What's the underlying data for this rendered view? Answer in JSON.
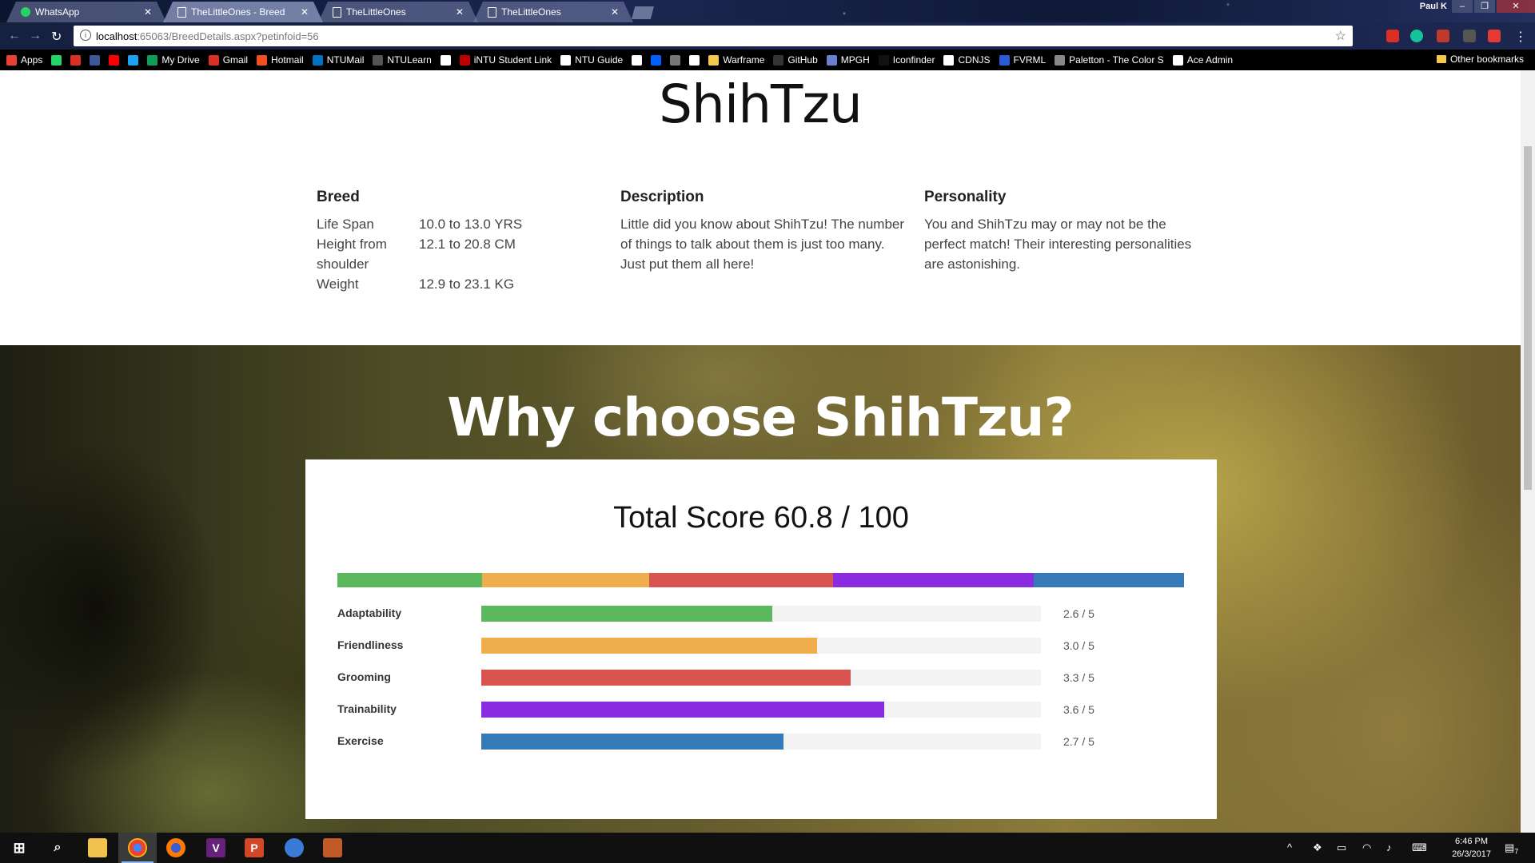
{
  "browser": {
    "tabs": [
      {
        "title": "WhatsApp",
        "icon": "whatsapp-icon"
      },
      {
        "title": "TheLittleOnes - Breed",
        "icon": "document-icon"
      },
      {
        "title": "TheLittleOnes",
        "icon": "document-icon"
      },
      {
        "title": "TheLittleOnes",
        "icon": "document-icon"
      }
    ],
    "profile_name": "Paul K",
    "url_host": "localhost",
    "url_path": ":65063/BreedDetails.aspx?petinfoid=56",
    "bookmarks": [
      {
        "label": "Apps",
        "color": "#e94235"
      },
      {
        "label": "",
        "color": "#25d366"
      },
      {
        "label": "",
        "color": "#d93025"
      },
      {
        "label": "",
        "color": "#3b5998"
      },
      {
        "label": "",
        "color": "#ff0000"
      },
      {
        "label": "",
        "color": "#1da1f2"
      },
      {
        "label": "My Drive",
        "color": "#0f9d58"
      },
      {
        "label": "Gmail",
        "color": "#d93025"
      },
      {
        "label": "Hotmail",
        "color": "#f25022"
      },
      {
        "label": "NTUMail",
        "color": "#0072c6"
      },
      {
        "label": "NTULearn",
        "color": "#555555"
      },
      {
        "label": "",
        "color": "#ffffff"
      },
      {
        "label": "iNTU Student Link",
        "color": "#c00000"
      },
      {
        "label": "NTU Guide",
        "color": "#ffffff"
      },
      {
        "label": "",
        "color": "#ffffff"
      },
      {
        "label": "",
        "color": "#0061fe"
      },
      {
        "label": "",
        "color": "#777777"
      },
      {
        "label": "",
        "color": "#ffffff"
      },
      {
        "label": "Warframe",
        "color": "#f6c94a"
      },
      {
        "label": "GitHub",
        "color": "#333333"
      },
      {
        "label": "MPGH",
        "color": "#6a7fd0"
      },
      {
        "label": "Iconfinder",
        "color": "#111111"
      },
      {
        "label": "CDNJS",
        "color": "#ffffff"
      },
      {
        "label": "FVRML",
        "color": "#2a5bd7"
      },
      {
        "label": "Paletton - The Color S",
        "color": "#888888"
      },
      {
        "label": "Ace Admin",
        "color": "#ffffff"
      }
    ],
    "other_bookmarks": "Other bookmarks"
  },
  "page": {
    "title": "ShihTzu",
    "breed": {
      "heading": "Breed",
      "specs": [
        {
          "label": "Life Span",
          "value": "10.0 to 13.0 YRS"
        },
        {
          "label": "Height from shoulder",
          "value": "12.1 to 20.8 CM"
        },
        {
          "label": "Weight",
          "value": "12.9 to 23.1 KG"
        }
      ]
    },
    "description": {
      "heading": "Description",
      "text": "Little did you know about ShihTzu! The number of things to talk about them is just too many. Just put them all here!"
    },
    "personality": {
      "heading": "Personality",
      "text": "You and ShihTzu may or may not be the perfect match! Their interesting personalities are astonishing."
    },
    "hero_title": "Why choose ShihTzu?",
    "total_score": "Total Score 60.8 / 100",
    "traits": [
      {
        "label": "Adaptability",
        "score": 2.6,
        "max": 5,
        "display": "2.6 / 5",
        "color": "#5cb85c"
      },
      {
        "label": "Friendliness",
        "score": 3.0,
        "max": 5,
        "display": "3.0 / 5",
        "color": "#f0ad4e"
      },
      {
        "label": "Grooming",
        "score": 3.3,
        "max": 5,
        "display": "3.3 / 5",
        "color": "#d9534f"
      },
      {
        "label": "Trainability",
        "score": 3.6,
        "max": 5,
        "display": "3.6 / 5",
        "color": "#8a2be2"
      },
      {
        "label": "Exercise",
        "score": 2.7,
        "max": 5,
        "display": "2.7 / 5",
        "color": "#337ab7"
      }
    ]
  },
  "taskbar": {
    "time": "6:46 PM",
    "date": "26/3/2017",
    "notification_count": "7"
  }
}
